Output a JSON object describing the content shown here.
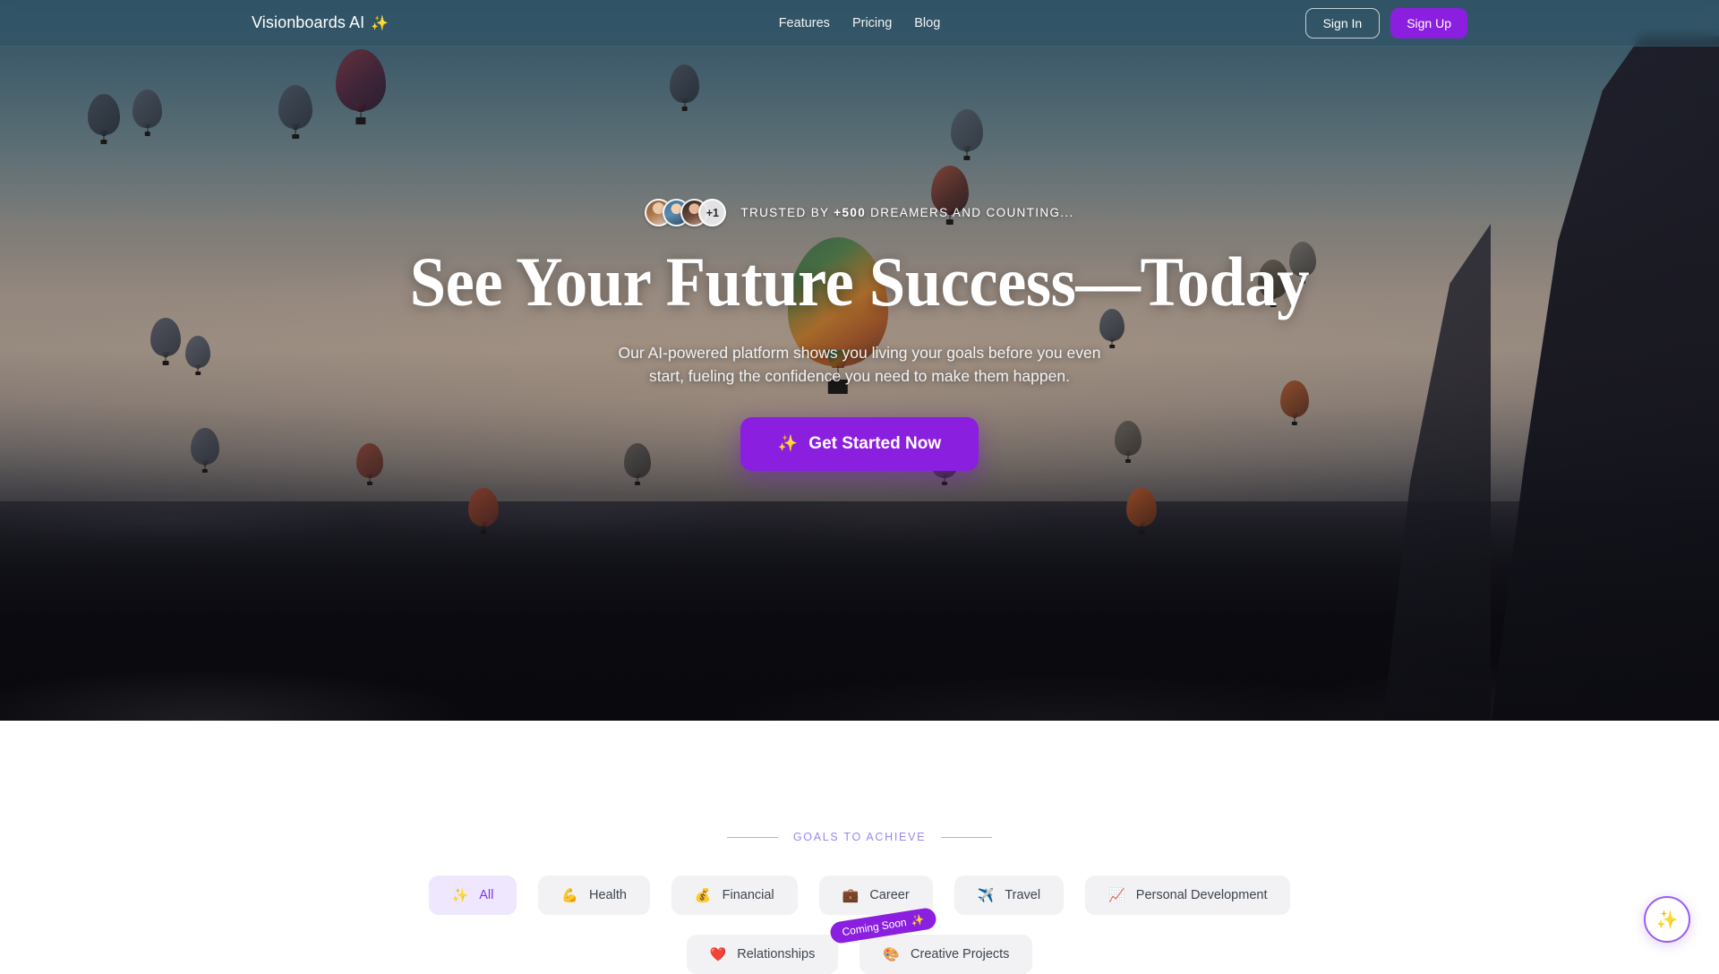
{
  "brand": {
    "name": "Visionboards AI",
    "emoji": "✨"
  },
  "nav": {
    "links": [
      {
        "label": "Features"
      },
      {
        "label": "Pricing"
      },
      {
        "label": "Blog"
      }
    ],
    "sign_in": "Sign In",
    "sign_up": "Sign Up"
  },
  "hero": {
    "trust": {
      "avatar_more": "+1",
      "prefix": "Trusted by ",
      "count": "+500",
      "suffix": " dreamers and counting..."
    },
    "headline": "See Your Future Success—Today",
    "subtitle": "Our AI-powered platform shows you living your goals before you even start, fueling the confidence you need to make them happen.",
    "cta_label": "Get Started Now",
    "cta_emoji": "✨"
  },
  "goals": {
    "eyebrow": "Goals to Achieve",
    "categories": [
      {
        "label": "All",
        "emoji": "✨",
        "active": true
      },
      {
        "label": "Health",
        "emoji": "💪",
        "active": false
      },
      {
        "label": "Financial",
        "emoji": "💰",
        "active": false
      },
      {
        "label": "Career",
        "emoji": "💼",
        "active": false
      },
      {
        "label": "Travel",
        "emoji": "✈️",
        "active": false
      },
      {
        "label": "Personal Development",
        "emoji": "📈",
        "active": false
      }
    ],
    "categories_row2": [
      {
        "label": "Relationships",
        "emoji": "❤️"
      },
      {
        "label": "Creative Projects",
        "emoji": "🎨"
      }
    ],
    "coming_soon": {
      "label": "Coming Soon",
      "emoji": "✨"
    }
  },
  "fab": {
    "emoji": "✨"
  },
  "colors": {
    "accent": "#8b1fe0",
    "accent_light": "#9d86ef",
    "pill_active_bg": "#eee7fd",
    "pill_active_text": "#7c3aed",
    "pill_bg": "#f2f2f4"
  }
}
